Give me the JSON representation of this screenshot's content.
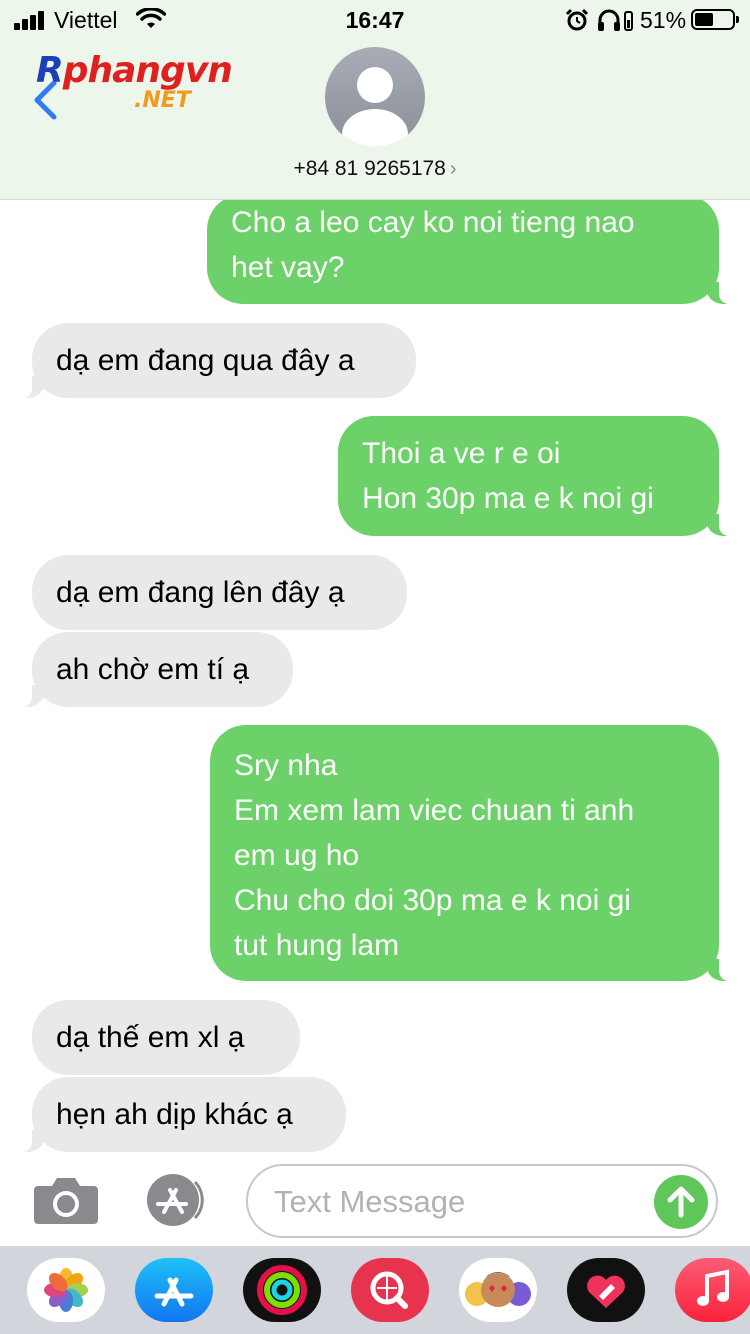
{
  "status_bar": {
    "carrier": "Viettel",
    "time": "16:47",
    "battery_percent": "51%",
    "battery_level": 0.51
  },
  "header": {
    "logo_main": "Rphangvn",
    "logo_main_head": "R",
    "logo_main_rest": "phangvn",
    "logo_suffix": ".NET",
    "contact": "+84 81 9265178",
    "contact_chevron": "›"
  },
  "messages": [
    {
      "direction": "sent",
      "lines": [
        "Cho a leo cay ko noi tieng nao",
        "het vay?"
      ]
    },
    {
      "direction": "received",
      "lines": [
        "dạ em đang qua đây a"
      ]
    },
    {
      "direction": "sent",
      "lines": [
        "Thoi a ve r e oi",
        "Hon 30p ma e k noi gi"
      ]
    },
    {
      "direction": "received",
      "lines": [
        "dạ em đang lên đây ạ"
      ]
    },
    {
      "direction": "received",
      "lines": [
        "ah chờ em tí ạ"
      ]
    },
    {
      "direction": "sent",
      "lines": [
        "Sry nha",
        "Em xem lam viec chuan ti anh",
        "em ug ho",
        "Chu cho doi 30p ma e k noi gi",
        "tut hung lam"
      ]
    },
    {
      "direction": "received",
      "lines": [
        "dạ thế em xl ạ"
      ]
    },
    {
      "direction": "received",
      "lines": [
        "hẹn ah dịp khác ạ"
      ]
    }
  ],
  "input": {
    "placeholder": "Text Message",
    "value": ""
  },
  "app_drawer": [
    {
      "icon": "photos-icon"
    },
    {
      "icon": "app-store-icon"
    },
    {
      "icon": "activity-icon"
    },
    {
      "icon": "web-search-icon"
    },
    {
      "icon": "memoji-icon"
    },
    {
      "icon": "digital-touch-icon"
    },
    {
      "icon": "music-icon"
    }
  ],
  "colors": {
    "sent_bubble": "#6cd168",
    "received_bubble": "#e9e9eb",
    "header_bg": "#edf6ea",
    "send_button": "#5fc65a",
    "back_chevron": "#2f7cf6"
  }
}
